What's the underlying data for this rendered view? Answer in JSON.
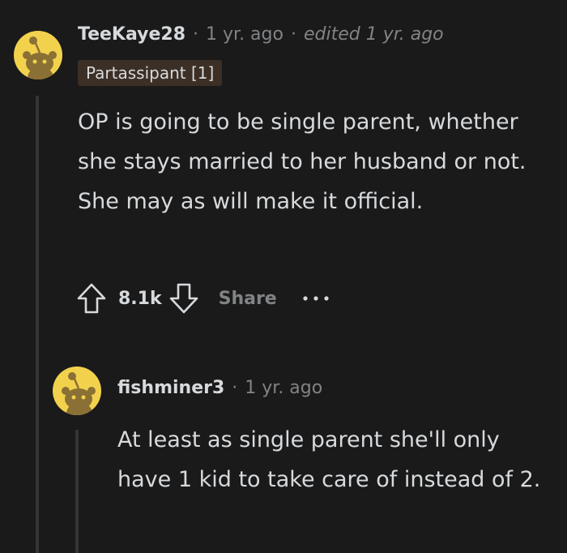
{
  "comment": {
    "username": "TeeKaye28",
    "separator": "·",
    "time": "1 yr. ago",
    "edited": "edited 1 yr. ago",
    "flair": "Partassipant [1]",
    "body": "OP is going to be single parent, whether she stays married to her husband or not. She may as will make it official.",
    "score": "8.1k",
    "share_label": "Share",
    "avatar_color": "#f2d24d"
  },
  "reply": {
    "username": "fishminer3",
    "separator": "·",
    "time": "1 yr. ago",
    "body": "At least as single parent she'll only have 1 kid to take care of instead of 2.",
    "avatar_color": "#f2d24d"
  },
  "icons": {
    "upvote": "arrow-up-icon",
    "downvote": "arrow-down-icon",
    "more": "ellipsis-icon",
    "avatar": "snoo-icon"
  }
}
